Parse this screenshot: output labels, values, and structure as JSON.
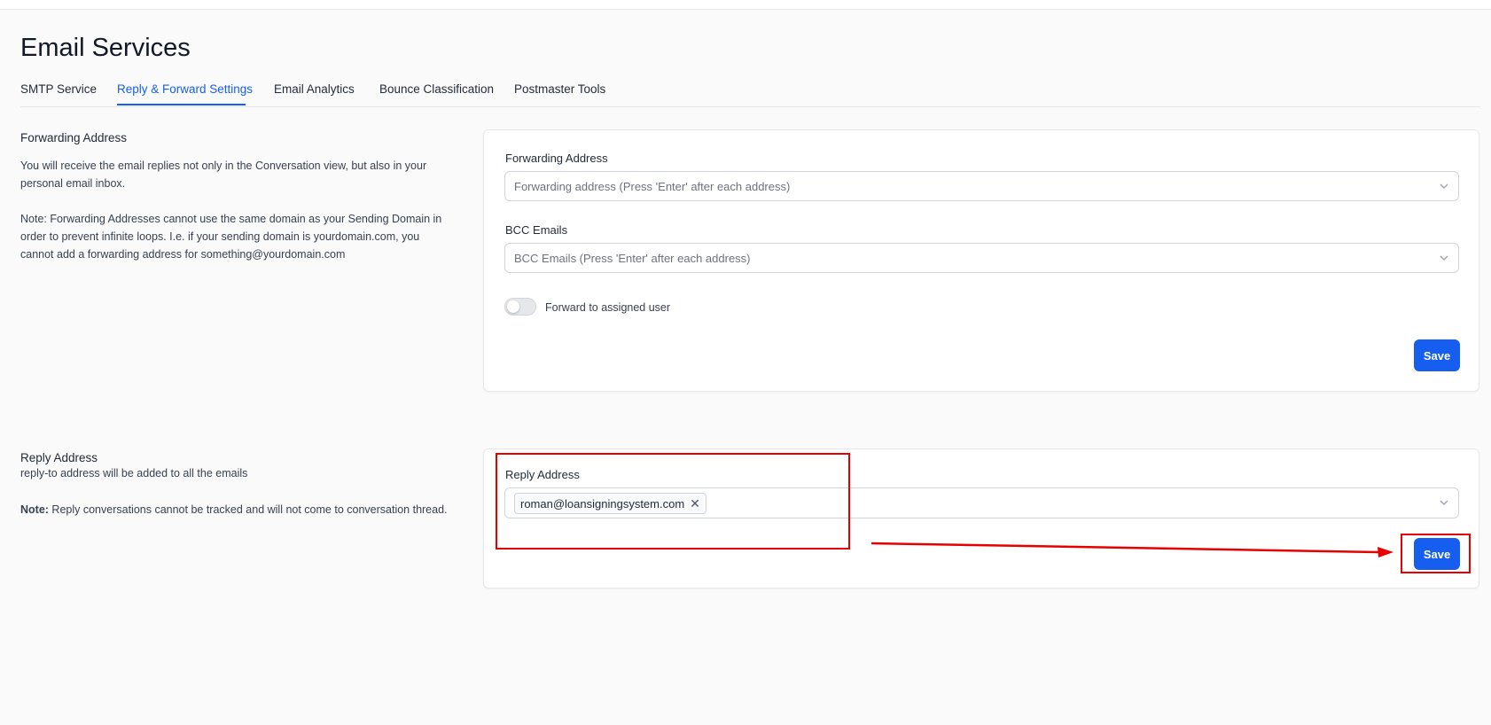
{
  "page": {
    "title": "Email Services"
  },
  "tabs": [
    {
      "label": "SMTP Service",
      "active": false
    },
    {
      "label": "Reply & Forward Settings",
      "active": true
    },
    {
      "label": "Email Analytics",
      "active": false
    },
    {
      "label": "Bounce Classification",
      "active": false
    },
    {
      "label": "Postmaster Tools",
      "active": false
    }
  ],
  "forwarding": {
    "section_title": "Forwarding Address",
    "desc1_line1": "You will receive the email replies not only in the Conversation view, but also in your",
    "desc1_line2": "personal email inbox.",
    "desc2_line1": "Note: Forwarding Addresses cannot use the same domain as your Sending Domain in",
    "desc2_line2": "order to prevent infinite loops. I.e. if your sending domain is yourdomain.com, you",
    "desc2_line3": "cannot add a forwarding address for something@yourdomain.com",
    "field_label": "Forwarding Address",
    "field_placeholder": "Forwarding address (Press 'Enter' after each address)",
    "bcc_label": "BCC Emails",
    "bcc_placeholder": "BCC Emails (Press 'Enter' after each address)",
    "toggle_label": "Forward to assigned user",
    "toggle_on": false,
    "save_label": "Save"
  },
  "reply": {
    "section_title": "Reply Address",
    "subtitle": "reply-to address will be added to all the emails",
    "note_bold": "Note:",
    "note_text": " Reply conversations cannot be tracked and will not come to conversation thread.",
    "field_label": "Reply Address",
    "tag_value": "roman@loansigningsystem.com",
    "tag_remove": "✕",
    "save_label": "Save"
  },
  "colors": {
    "accent": "#155eef",
    "annotation": "#e60000",
    "background": "#fafafa"
  },
  "icons": {
    "chevron": "chevron-down-icon",
    "remove": "close-icon"
  }
}
